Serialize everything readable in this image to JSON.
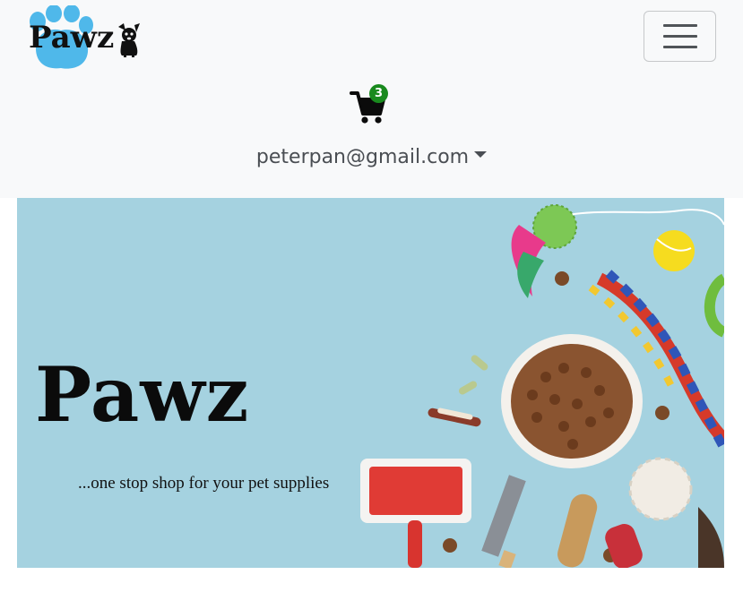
{
  "navbar": {
    "brand_text": "Pawz",
    "toggler_icon": "hamburger-icon",
    "cart": {
      "icon": "shopping-cart-icon",
      "count": "3"
    },
    "user": {
      "email": "peterpan@gmail.com",
      "caret_icon": "caret-down-icon"
    }
  },
  "hero": {
    "title": "Pawz",
    "tagline": "...one stop shop for your pet supplies"
  },
  "colors": {
    "navbar_bg": "#f8f9fa",
    "paw_blue": "#4fb8ea",
    "badge_green": "#198a1e",
    "hero_bg": "#a5d2e0"
  }
}
